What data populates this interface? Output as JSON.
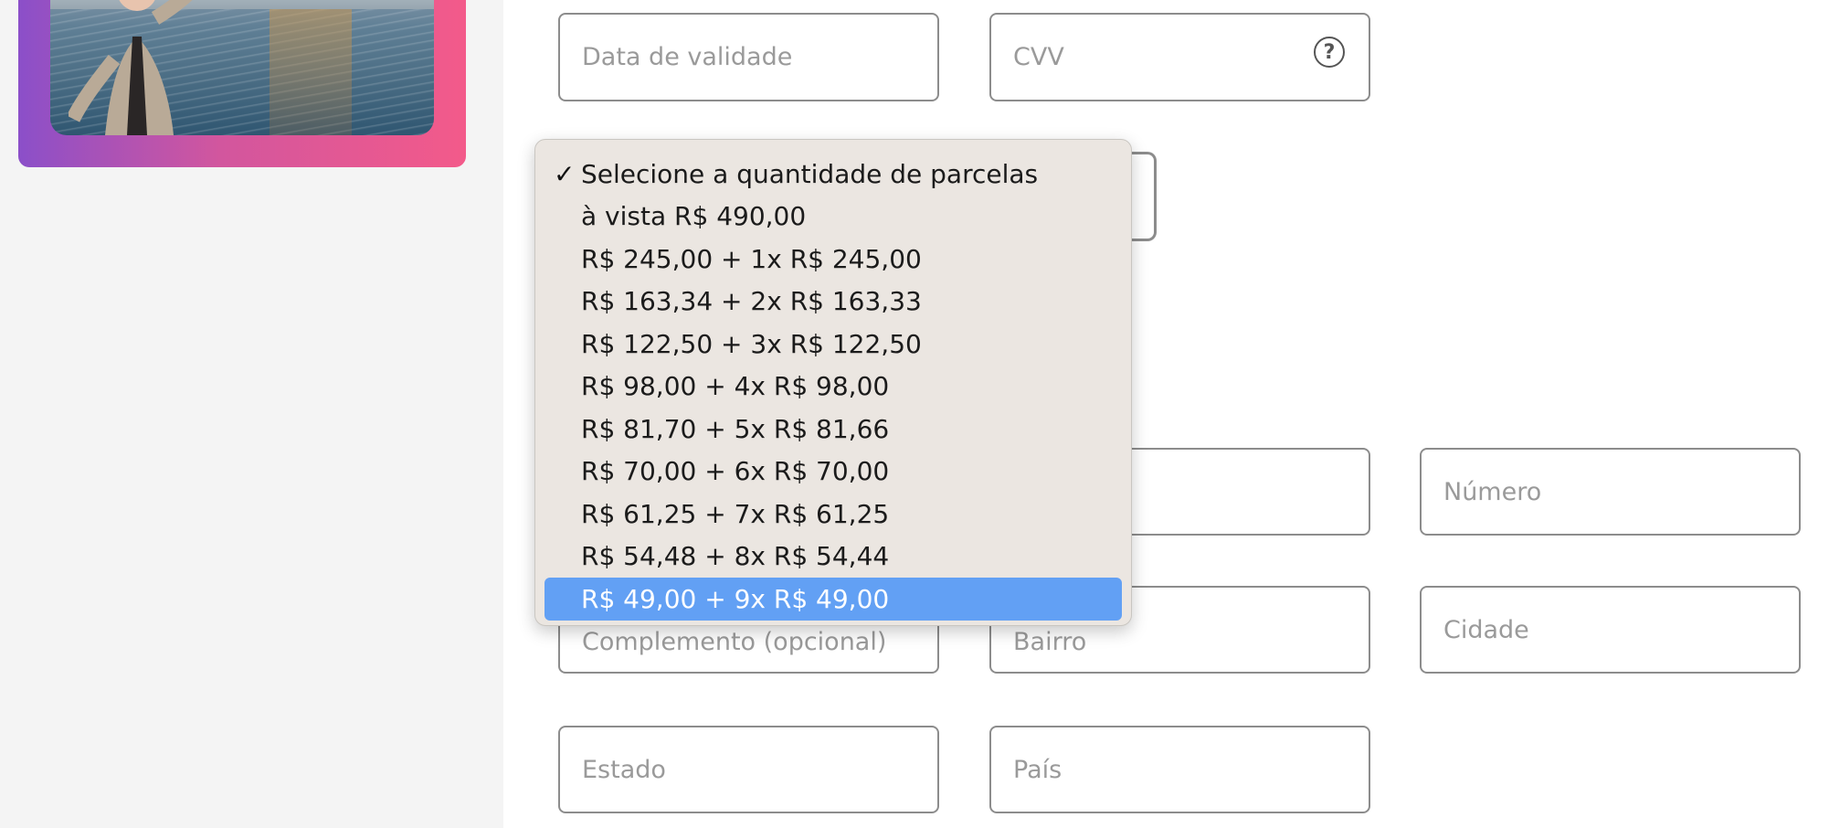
{
  "payment": {
    "expiry_placeholder": "Data de validade",
    "cvv_placeholder": "CVV",
    "cvv_help_icon": "?"
  },
  "installments": {
    "options": [
      "Selecione a quantidade de parcelas",
      "à vista R$ 490,00",
      "R$ 245,00 + 1x R$ 245,00",
      "R$ 163,34 + 2x R$ 163,33",
      "R$ 122,50 + 3x R$ 122,50",
      "R$ 98,00 + 4x R$ 98,00",
      "R$ 81,70 + 5x R$ 81,66",
      "R$ 70,00 + 6x R$ 70,00",
      "R$ 61,25 + 7x R$ 61,25",
      "R$ 54,48 + 8x R$ 54,44",
      "R$ 49,00 + 9x R$ 49,00"
    ],
    "checked_option_index": 0,
    "highlighted_option_index": 10,
    "checkmark": "✓"
  },
  "address": {
    "number_placeholder": "Número",
    "complement_placeholder": "Complemento (opcional)",
    "neighborhood_placeholder": "Bairro",
    "city_placeholder": "Cidade",
    "state_placeholder": "Estado",
    "country_placeholder": "País"
  },
  "colors": {
    "highlight": "#62a0f4",
    "card_gradient_start": "#8b4fc9",
    "card_gradient_end": "#f35a8a"
  }
}
